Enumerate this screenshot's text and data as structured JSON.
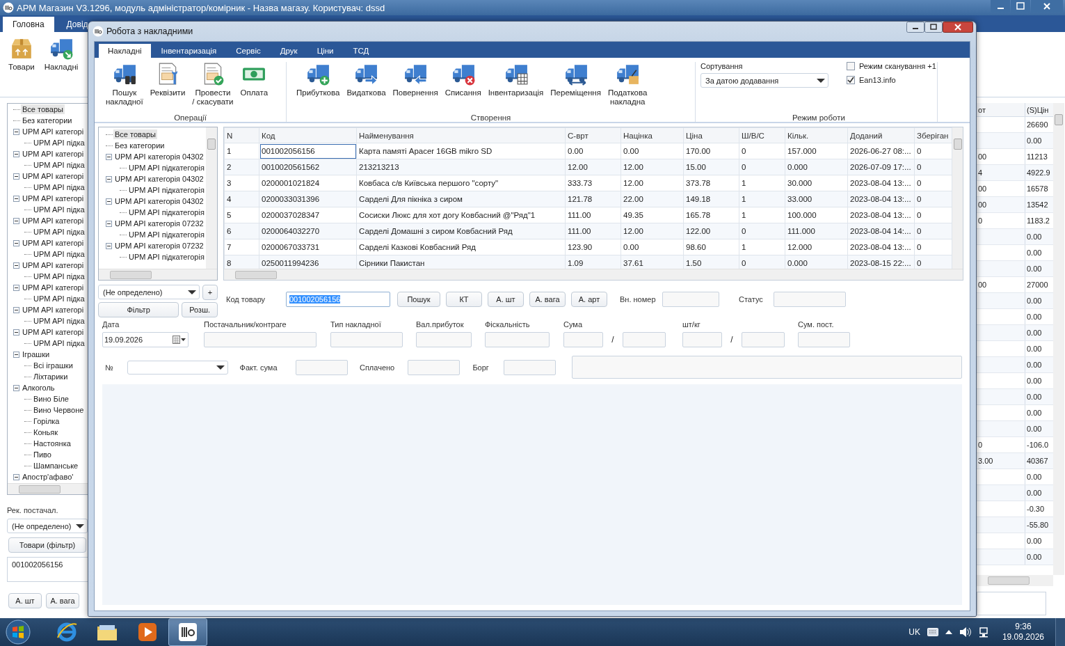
{
  "main_window": {
    "title": "АРМ Магазин V3.1296, модуль адміністратор/комірник - Назва магазу. Користувач: dssd",
    "tabs": [
      {
        "label": "Головна",
        "selected": true
      },
      {
        "label": "Довід",
        "selected": false
      }
    ],
    "ribbon_buttons": [
      "Товари",
      "Накладні"
    ],
    "category_tree": [
      {
        "label": "Все товары",
        "selected": true
      },
      {
        "label": "Без категории",
        "selected": false
      },
      {
        "label": "UPM API категорі",
        "selected": false,
        "expanded": true,
        "children": [
          {
            "label": "UPM API підка",
            "selected": false
          }
        ]
      },
      {
        "label": "UPM API категорі",
        "selected": false,
        "expanded": true,
        "children": [
          {
            "label": "UPM API підка",
            "selected": false
          }
        ]
      },
      {
        "label": "UPM API категорі",
        "selected": false,
        "expanded": true,
        "children": [
          {
            "label": "UPM API підка",
            "selected": false
          }
        ]
      },
      {
        "label": "UPM API категорі",
        "selected": false,
        "expanded": true,
        "children": [
          {
            "label": "UPM API підка",
            "selected": false
          }
        ]
      },
      {
        "label": "UPM API категорі",
        "selected": false,
        "expanded": true,
        "children": [
          {
            "label": "UPM API підка",
            "selected": false
          }
        ]
      },
      {
        "label": "UPM API категорі",
        "selected": false,
        "expanded": true,
        "children": [
          {
            "label": "UPM API підка",
            "selected": false
          }
        ]
      },
      {
        "label": "UPM API категорі",
        "selected": false,
        "expanded": true,
        "children": [
          {
            "label": "UPM API підка",
            "selected": false
          }
        ]
      },
      {
        "label": "UPM API категорі",
        "selected": false,
        "expanded": true,
        "children": [
          {
            "label": "UPM API підка",
            "selected": false
          }
        ]
      },
      {
        "label": "UPM API категорі",
        "selected": false,
        "expanded": true,
        "children": [
          {
            "label": "UPM API підка",
            "selected": false
          }
        ]
      },
      {
        "label": "UPM API категорі",
        "selected": false,
        "expanded": true,
        "children": [
          {
            "label": "UPM API підка",
            "selected": false
          }
        ]
      },
      {
        "label": "Іграшки",
        "selected": false,
        "expanded": true,
        "children": [
          {
            "label": "Всі іграшки",
            "selected": false
          },
          {
            "label": "Ліхтарики",
            "selected": false
          }
        ]
      },
      {
        "label": "Алкоголь",
        "selected": false,
        "expanded": true,
        "children": [
          {
            "label": "Вино Біле",
            "selected": false
          },
          {
            "label": "Вино Червоне",
            "selected": false
          },
          {
            "label": "Горілка",
            "selected": false
          },
          {
            "label": "Коньяк",
            "selected": false
          },
          {
            "label": "Настоянка",
            "selected": false
          },
          {
            "label": "Пиво",
            "selected": false
          },
          {
            "label": "Шампанське",
            "selected": false
          }
        ]
      },
      {
        "label": "Апостр'афаво'",
        "selected": false,
        "expanded": true
      }
    ],
    "supplier_label": "Рек. постачал.",
    "supplier_combo": "(Не определено)",
    "goods_filter_button": "Товари (фільтр)",
    "code_box": "001002056156",
    "buttons": [
      "А. шт",
      "А. вага"
    ],
    "table": {
      "columns": [
        "от",
        "(S)Цін"
      ],
      "rows": [
        {
          "column_2": "26690"
        },
        {
          "column_2": "0.00"
        },
        {
          "column_1": "00",
          "column_2": "11213"
        },
        {
          "column_1": "4",
          "column_2": "4922.9"
        },
        {
          "column_1": "00",
          "column_2": "16578"
        },
        {
          "column_1": "00",
          "column_2": "13542"
        },
        {
          "column_1": "0",
          "column_2": "1183.2"
        },
        {
          "column_2": "0.00"
        },
        {
          "column_2": "0.00"
        },
        {
          "column_2": "0.00"
        },
        {
          "column_1": "00",
          "column_2": "27000"
        },
        {
          "column_2": "0.00"
        },
        {
          "column_2": "0.00"
        },
        {
          "column_2": "0.00"
        },
        {
          "column_2": "0.00"
        },
        {
          "column_2": "0.00"
        },
        {
          "column_2": "0.00"
        },
        {
          "column_2": "0.00"
        },
        {
          "column_2": "0.00"
        },
        {
          "column_2": "0.00"
        },
        {
          "column_1": "0",
          "column_2": "-106.0"
        },
        {
          "column_1": "3.00",
          "column_2": "40367"
        },
        {
          "column_2": "0.00"
        },
        {
          "column_2": "0.00"
        },
        {
          "column_2": "-0.30"
        },
        {
          "column_2": "-55.80"
        },
        {
          "column_2": "0.00"
        },
        {
          "column_2": "0.00"
        }
      ]
    }
  },
  "dialog": {
    "title": "Робота з накладними",
    "tabs": [
      {
        "label": "Накладні",
        "selected": true
      },
      {
        "label": "Інвентаризація",
        "selected": false
      },
      {
        "label": "Сервіс",
        "selected": false
      },
      {
        "label": "Друк",
        "selected": false
      },
      {
        "label": "Ціни",
        "selected": false
      },
      {
        "label": "ТСД",
        "selected": false
      }
    ],
    "ribbon_groups": [
      {
        "label": "Операції",
        "buttons": [
          "Пошук\nнакладної",
          "Реквізити",
          "Провести\n/ скасувати",
          "Оплата"
        ]
      },
      {
        "label": "Створення",
        "buttons": [
          "Прибуткова",
          "Видаткова",
          "Повернення",
          "Списання",
          "Інвентаризація",
          "Переміщення",
          "Податкова\nнакладна"
        ]
      }
    ],
    "work_mode": {
      "label": "Режим роботи",
      "sort_label": "Сортування",
      "sort_value": "За датою додавання",
      "options": [
        {
          "label": "Режим сканування +1",
          "checked": false
        },
        {
          "label": "Ean13.info",
          "checked": true
        }
      ]
    },
    "category_tree": [
      {
        "label": "Все товары",
        "selected": true
      },
      {
        "label": "Без категории",
        "selected": false
      },
      {
        "label": "UPM API категорія 04302",
        "selected": false,
        "expanded": true,
        "children": [
          {
            "label": "UPM API підкатегорія",
            "selected": false
          }
        ]
      },
      {
        "label": "UPM API категорія 04302",
        "selected": false,
        "expanded": true,
        "children": [
          {
            "label": "UPM API підкатегорія",
            "selected": false
          }
        ]
      },
      {
        "label": "UPM API категорія 04302",
        "selected": false,
        "expanded": true,
        "children": [
          {
            "label": "UPM API підкатегорія",
            "selected": false
          }
        ]
      },
      {
        "label": "UPM API категорія 07232",
        "selected": false,
        "expanded": true,
        "children": [
          {
            "label": "UPM API підкатегорія",
            "selected": false
          }
        ]
      },
      {
        "label": "UPM API категорія 07232",
        "selected": false,
        "expanded": true,
        "children": [
          {
            "label": "UPM API підкатегорія",
            "selected": false
          }
        ]
      }
    ],
    "table": {
      "columns": [
        "N",
        "Код",
        "Найменування",
        "С-врт",
        "Націнка",
        "Ціна",
        "Ш/В/С",
        "Кільк.",
        "Доданий",
        "Зберіган"
      ],
      "rows": [
        {
          "focused": true,
          "cells": [
            "1",
            "001002056156",
            "Карта памяті Apacer 16GB mikro SD",
            "0.00",
            "0.00",
            "170.00",
            "0",
            "157.000",
            "2026-06-27 08:...",
            "0"
          ]
        },
        {
          "focused": false,
          "cells": [
            "2",
            "0010020561562",
            "213213213",
            "12.00",
            "12.00",
            "15.00",
            "0",
            "0.000",
            "2026-07-09 17:...",
            "0"
          ]
        },
        {
          "focused": false,
          "cells": [
            "3",
            "0200001021824",
            "Ковбаса с/в Київська першого \"сорту\"",
            "333.73",
            "12.00",
            "373.78",
            "1",
            "30.000",
            "2023-08-04 13:...",
            "0"
          ]
        },
        {
          "focused": false,
          "cells": [
            "4",
            "0200033031396",
            "Сарделі Для пікніка з сиром",
            "121.78",
            "22.00",
            "149.18",
            "1",
            "33.000",
            "2023-08-04 13:...",
            "0"
          ]
        },
        {
          "focused": false,
          "cells": [
            "5",
            "0200037028347",
            "Сосиски Люкс для хот догу Ковбасний @\"Ряд\"1",
            "111.00",
            "49.35",
            "165.78",
            "1",
            "100.000",
            "2023-08-04 13:...",
            "0"
          ]
        },
        {
          "focused": false,
          "cells": [
            "6",
            "0200064032270",
            "Сарделі Домашні з сиром Ковбасний Ряд",
            "111.00",
            "12.00",
            "122.00",
            "0",
            "111.000",
            "2023-08-04 14:...",
            "0"
          ]
        },
        {
          "focused": false,
          "cells": [
            "7",
            "0200067033731",
            "Сарделі Казкові Ковбасний Ряд",
            "123.90",
            "0.00",
            "98.60",
            "1",
            "12.000",
            "2023-08-04 13:...",
            "0"
          ]
        },
        {
          "focused": false,
          "cells": [
            "8",
            "0250011994236",
            "Сірники Пакистан",
            "1.09",
            "37.61",
            "1.50",
            "0",
            "0.000",
            "2023-08-15 22:...",
            "0"
          ]
        }
      ]
    },
    "form": {
      "filter_combo": "(Не определено)",
      "add_button": "+",
      "filter_button": "Фільтр",
      "extended_button": "Розш.",
      "code_label": "Код товару",
      "code_value": "001002056156",
      "code_value_selected": true,
      "search_buttons": [
        "Пошук",
        "КТ",
        "А. шт",
        "А. вага",
        "А. арт"
      ],
      "internal_number_label": "Вн. номер",
      "status_label": "Статус",
      "date_label": "Дата",
      "date_value": "19.09.2026",
      "supplier_label": "Постачальник/контраге",
      "invoice_type_label": "Тип накладної",
      "currency_profit_label": "Вал.прибуток",
      "fiscal_label": "Фіскальність",
      "sum_label": "Сума",
      "sum_separator": "/",
      "pcs_label": "шт/кг",
      "pcs_separator": "/",
      "supplier_sum_label": "Сум. пост.",
      "number_label": "№",
      "actual_sum_label": "Факт. сума",
      "paid_label": "Сплачено",
      "debt_label": "Борг"
    }
  },
  "taskbar": {
    "apps": [
      {
        "selected": false
      },
      {
        "selected": false
      },
      {
        "selected": false
      },
      {
        "selected": true
      }
    ],
    "language": "UK",
    "time": "9:36",
    "date": "19.09.2026"
  }
}
